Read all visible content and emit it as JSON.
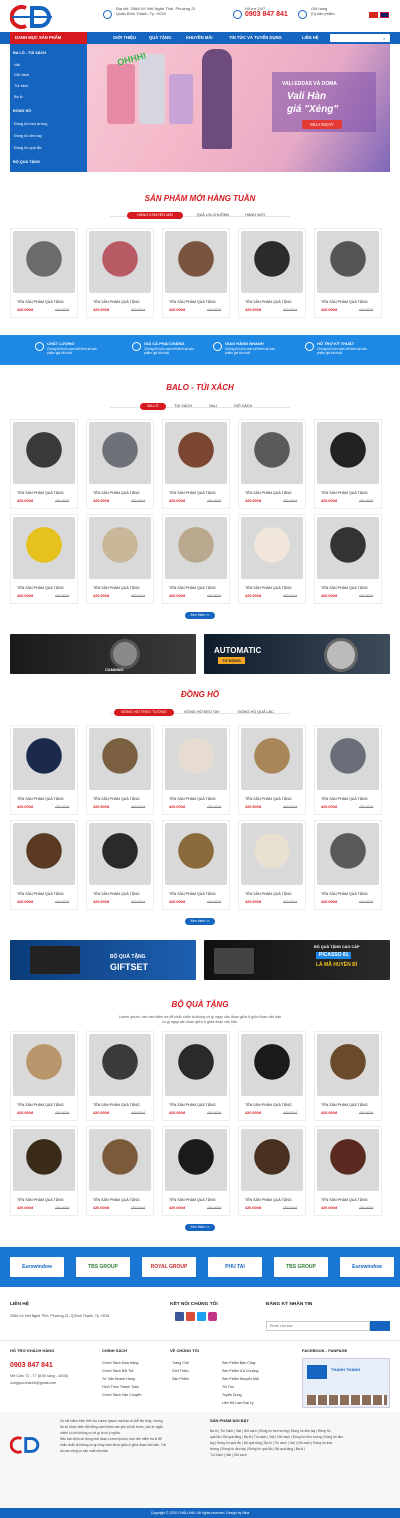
{
  "header": {
    "address_lines": [
      "Địa chỉ: 298A Xô Viết Nghệ Tĩnh, Phường 21",
      "Quận Bình Thạnh, Tp. HCM"
    ],
    "hotline_label": "Hỗ trợ 24/7",
    "hotline": "0903 847 841",
    "cart_label": "Giỏ hàng",
    "cart_count": "(0) sản phẩm"
  },
  "nav": {
    "category_label": "DANH MỤC SẢN PHẨM",
    "items": [
      "GIỚI THIỆU",
      "QUÀ TẶNG",
      "KHUYẾN MÃI",
      "TIN TỨC VÀ TUYỂN DỤNG",
      "LIÊN HỆ"
    ]
  },
  "sidebar": {
    "items": [
      "BA LÔ - TÚI XÁCH",
      "Vali",
      "Giỏ xách",
      "Túi xách",
      "Ba lô",
      "ĐỒNG HỒ",
      "Đồng hồ treo tường",
      "Đồng hồ đeo tay",
      "Đồng hồ quả lắc",
      "BỘ QUÀ TẶNG"
    ]
  },
  "banner": {
    "brand": "VALI EDDAS VÀ DOMA",
    "headline1": "Vali Hàn",
    "headline2": "giá \"Xẻng\"",
    "cta": "MUA NGAY",
    "sticker": "OHHH!"
  },
  "product": {
    "name": "TÊN SẢN PHẨM QUÀ TẶNG",
    "price": "420.000đ",
    "old_price": "480.000đ",
    "more": "Xem thêm >>"
  },
  "weekly": {
    "title": "SẢN PHẨM MỚI HÀNG TUẦN",
    "tabs": [
      "HÀNG KHUYẾN MÃI",
      "QUÀ ƯA CHUỘNG",
      "HÀNG MỚI"
    ]
  },
  "features": [
    {
      "title": "CHẤT LƯỢNG",
      "desc": "Chúng tôi luôn cam kết đem lại sản phẩm giá tốt nhất."
    },
    {
      "title": "GIÁ CẢ PHẢI CHĂNG",
      "desc": "Chúng tôi luôn cam kết đem lại sản phẩm giá tốt nhất."
    },
    {
      "title": "GIAO HÀNG NHANH",
      "desc": "Chúng tôi luôn cam kết đem lại sản phẩm giá tốt nhất."
    },
    {
      "title": "HỖ TRỢ KỸ THUẬT",
      "desc": "Chúng tôi luôn cam kết đem lại sản phẩm giá tốt nhất."
    }
  ],
  "bags": {
    "title": "BALO - TÚI XÁCH",
    "tabs": [
      "BA LÔ",
      "TÚI XÁCH",
      "VALI",
      "GIỎ XÁCH"
    ]
  },
  "ad1": {
    "left": "CANDINO",
    "right": "AUTOMATIC",
    "right_sub": "TỰ ĐỘNG"
  },
  "watches": {
    "title": "ĐỒNG HỒ",
    "tabs": [
      "ĐỒNG HỒ TREO TƯỜNG",
      "ĐỒNG HỒ ĐEO TAY",
      "ĐỒNG HỒ QUẢ LẮC"
    ]
  },
  "ad2": {
    "left": "BỘ QUÀ TẶNG",
    "left_sub": "GIFTSET",
    "right_top": "BỘ QUÀ TẶNG CAO CẤP",
    "right_mid": "PICASSO 81",
    "right_bot": "LÁ MÃ HUYỀN BÍ"
  },
  "gifts": {
    "title": "BỘ QUÀ TẶNG",
    "desc_lines": [
      "Lorem Ipsum, bạn nên kiếm tra để chắc chắn là không có gì ngay căn đoạn giữa ở giữa đoạn văn bản",
      "có gì ngay căn đoạn giữa ở giữa đoạn văn bản."
    ]
  },
  "partners": [
    "Eurowindow",
    "TBS GROUP",
    "ROYAL GROUP",
    "PHU TAI",
    "TBS GROUP",
    "Eurowindow"
  ],
  "footer": {
    "contact_title": "LIÊN HỆ",
    "contact_addr": "298A Xô Viết Nghệ Tĩnh, Phường 21, Q.Bình Thạnh, Tp. HCM",
    "social_title": "KẾT NỐI CHÚNG TÔI",
    "newsletter_title": "ĐĂNG KÝ NHẬN TIN",
    "newsletter_placeholder": "Email của bạn",
    "support_title": "HỖ TRỢ KHÁCH HÀNG",
    "support_phone": "0903 847 841",
    "support_time": "Mở Cửa: T2 - T7 (8:00 sáng - 18:00)",
    "support_email": "congtyco.thanhlt@gmail.com",
    "policy_title": "CHÍNH SÁCH",
    "policies": [
      "Chính Sách Mua Hàng",
      "Chính Sách Đổi Trả",
      "Tư Vấn Khách Hàng",
      "Hình Thức Thanh Toán",
      "Chính Sách Vận Chuyển"
    ],
    "about_title": "VỀ CHÚNG TÔI",
    "about1": [
      "Trang Chủ",
      "Giới Thiệu",
      "Sản Phẩm"
    ],
    "about2": [
      "Sản Phẩm Bán Chạy",
      "Sản Phẩm Ưa Chuộng",
      "Sản Phẩm Khuyến Mãi",
      "Tin Tức",
      "Tuyển Dụng",
      "Liên Hệ Làm Đại Lý"
    ],
    "fanpage_title": "FACEBOOK - FANPAGE",
    "fanpage_name": "THÀNH THÀNH",
    "about_text": [
      "Có rất nhiều biến thể của Lorem Ipsum mà bạn có thể tìm thấy, nhưng",
      "đa số được biến đổi bằng cách thêm các yếu tố hài hước, các từ ngẫu",
      "nhiên có khi không có vẻ gì là có ý nghĩa.",
      "Nếu bạn định sử dụng một đoạn Lorem Ipsum, bạn nên kiểm tra kĩ để",
      "chắc chắn là không có gì nhạy cảm được giấu ở giữa đoạn văn bản. Tất",
      "cả các công cụ sản xuất văn bản"
    ],
    "featured_title": "SẢN PHẨM NỔI BẬT",
    "featured_text": [
      "Ba lô | Túi Xách | Vali | Giỏ xách | Đồng hồ treo tường | Đồng hồ đeo tay | Đồng hồ",
      "quả lắc | Bộ quà tặng | Ba lô | Túi xách | Vali | Giỏ xách | Đồng hồ treo tường | Đồng hồ đeo",
      "tay | Đồng hồ quả lắc | Bộ quà tặng | Ba lô | Túi xách | Vali | Giỏ xách | Đồng hồ treo",
      "tường | Đồng hồ đeo tay | Đồng hồ quả lắc | Bộ quà tặng | Ba lô |",
      "Túi Xách | Vali | Giỏ xách"
    ],
    "copyright": "Copyright © 2020 CHẤU ANH. All rights reserved. Design by Nina"
  },
  "colors": {
    "brand_blue": "#1565c0",
    "brand_red": "#d71920"
  }
}
